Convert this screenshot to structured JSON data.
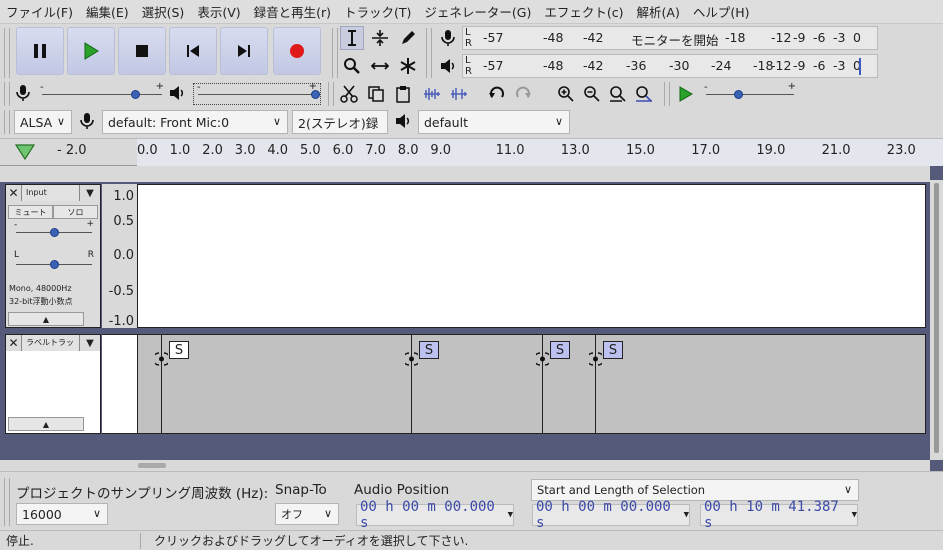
{
  "menu": [
    "ファイル(F)",
    "編集(E)",
    "選択(S)",
    "表示(V)",
    "録音と再生(r)",
    "トラック(T)",
    "ジェネレーター(G)",
    "エフェクト(c)",
    "解析(A)",
    "ヘルプ(H)"
  ],
  "meters": {
    "record": {
      "lr_l": "L",
      "lr_r": "R",
      "ticks": [
        "-57",
        "-48",
        "-42"
      ],
      "monitor_label": "モニターを開始",
      "ticks_right": [
        "-18",
        "-12",
        "-9",
        "-6",
        "-3",
        "0"
      ]
    },
    "playback": {
      "lr_l": "L",
      "lr_r": "R",
      "ticks": [
        "-57",
        "-48",
        "-42",
        "-36",
        "-30",
        "-24",
        "-18",
        "-12",
        "-9",
        "-6",
        "-3",
        "0"
      ]
    }
  },
  "sliders": {
    "plus": "+",
    "minus": "-",
    "record_level": 0.8,
    "playback_level": 1.0,
    "play_speed": 0.35
  },
  "devices": {
    "host": "ALSA",
    "input": "default: Front Mic:0",
    "channels": "2(ステレオ)録",
    "output": "default"
  },
  "ruler": {
    "ticks": [
      "- 2.0",
      "0.0",
      "1.0",
      "2.0",
      "3.0",
      "4.0",
      "5.0",
      "6.0",
      "7.0",
      "8.0",
      "9.0",
      "11.0",
      "13.0",
      "15.0",
      "17.0",
      "19.0",
      "21.0",
      "23.0"
    ]
  },
  "audio_track": {
    "name": "Input",
    "mute": "ミュート",
    "solo": "ソロ",
    "pan_l": "L",
    "pan_r": "R",
    "info1": "Mono, 48000Hz",
    "info2": "32-bit浮動小数点",
    "yaxis": [
      "1.0",
      "0.5",
      "0.0",
      "-0.5",
      "-1.0"
    ]
  },
  "label_track": {
    "name": "ラベルトラック",
    "labels": [
      {
        "text": "S"
      },
      {
        "text": "S"
      },
      {
        "text": "S"
      },
      {
        "text": "S"
      }
    ]
  },
  "selection_bar": {
    "rate_label": "プロジェクトのサンプリング周波数 (Hz):",
    "rate_value": "16000",
    "snap_label": "Snap-To",
    "snap_value": "オフ",
    "audio_pos_label": "Audio Position",
    "audio_pos_value": "00 h 00 m 00.000 s",
    "selection_mode": "Start and Length of Selection",
    "sel_start": "00 h 00 m 00.000 s",
    "sel_length": "00 h 10 m 41.387 s"
  },
  "status": {
    "state": "停止.",
    "hint": "クリックおよびドラッグしてオーディオを選択して下さい."
  },
  "colors": {
    "waveform": "#3f3fcc",
    "waveform_rms": "#6a6ae0",
    "label_fill": "#bcc1ef",
    "track_bg": "#55597a"
  }
}
